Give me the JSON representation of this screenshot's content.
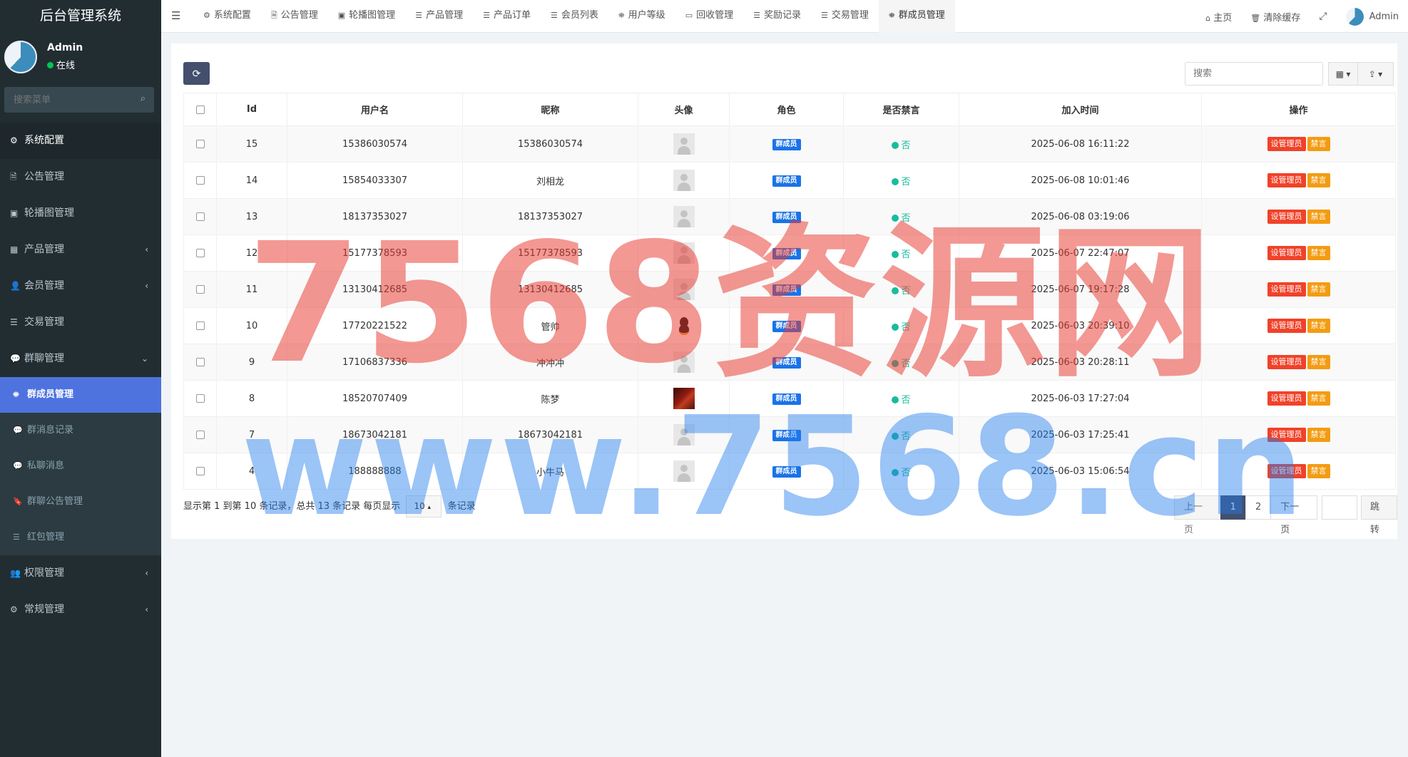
{
  "app": {
    "title": "后台管理系统"
  },
  "user": {
    "name": "Admin",
    "status": "在线"
  },
  "sidebar": {
    "search_placeholder": "搜索菜单",
    "items": [
      {
        "label": "系统配置",
        "icon": "gear-icon",
        "glyph": "⚙",
        "active": true
      },
      {
        "label": "公告管理",
        "icon": "file-icon",
        "glyph": "🗎"
      },
      {
        "label": "轮播图管理",
        "icon": "image-icon",
        "glyph": "▣"
      },
      {
        "label": "产品管理",
        "icon": "grid-icon",
        "glyph": "▦",
        "chevron": "‹"
      },
      {
        "label": "会员管理",
        "icon": "user-icon",
        "glyph": "👤",
        "chevron": "‹"
      },
      {
        "label": "交易管理",
        "icon": "list-icon",
        "glyph": "☰"
      },
      {
        "label": "群聊管理",
        "icon": "comments-icon",
        "glyph": "💬",
        "chevron": "⌄",
        "open": true
      }
    ],
    "group_chat_sub": [
      {
        "label": "群成员管理",
        "icon": "sitemap-icon",
        "glyph": "⛯",
        "active": true
      },
      {
        "label": "群消息记录",
        "icon": "comments-icon",
        "glyph": "💬"
      },
      {
        "label": "私聊消息",
        "icon": "comment-icon",
        "glyph": "💬"
      },
      {
        "label": "群聊公告管理",
        "icon": "bookmark-icon",
        "glyph": "🔖"
      },
      {
        "label": "红包管理",
        "icon": "list-icon",
        "glyph": "☰"
      }
    ],
    "bottom_items": [
      {
        "label": "权限管理",
        "icon": "group-icon",
        "glyph": "👥",
        "chevron": "‹"
      },
      {
        "label": "常规管理",
        "icon": "cogs-icon",
        "glyph": "⚙",
        "chevron": "‹"
      }
    ]
  },
  "topbar": {
    "tabs": [
      {
        "label": "系统配置",
        "icon": "gear-icon",
        "glyph": "⚙"
      },
      {
        "label": "公告管理",
        "icon": "file-icon",
        "glyph": "🗎"
      },
      {
        "label": "轮播图管理",
        "icon": "image-icon",
        "glyph": "▣"
      },
      {
        "label": "产品管理",
        "icon": "list-icon",
        "glyph": "☰"
      },
      {
        "label": "产品订单",
        "icon": "list-icon",
        "glyph": "☰"
      },
      {
        "label": "会员列表",
        "icon": "list-icon",
        "glyph": "☰"
      },
      {
        "label": "用户等级",
        "icon": "sitemap-icon",
        "glyph": "⛯"
      },
      {
        "label": "回收管理",
        "icon": "card-icon",
        "glyph": "▭"
      },
      {
        "label": "奖励记录",
        "icon": "list-icon",
        "glyph": "☰"
      },
      {
        "label": "交易管理",
        "icon": "list-icon",
        "glyph": "☰"
      },
      {
        "label": "群成员管理",
        "icon": "sitemap-icon",
        "glyph": "⛯",
        "active": true
      }
    ],
    "home_label": "主页",
    "clear_cache_label": "清除缓存",
    "user_label": "Admin"
  },
  "toolbar": {
    "search_placeholder": "搜索"
  },
  "table": {
    "columns": [
      "Id",
      "用户名",
      "昵称",
      "头像",
      "角色",
      "是否禁言",
      "加入时间",
      "操作"
    ],
    "role_label": "群成员",
    "mute_label": "否",
    "btn_admin": "设管理员",
    "btn_mute": "禁言",
    "rows": [
      {
        "id": "15",
        "username": "15386030574",
        "nickname": "15386030574",
        "avatar": "default",
        "joined": "2025-06-08 16:11:22"
      },
      {
        "id": "14",
        "username": "15854033307",
        "nickname": "刘相龙",
        "avatar": "default",
        "joined": "2025-06-08 10:01:46"
      },
      {
        "id": "13",
        "username": "18137353027",
        "nickname": "18137353027",
        "avatar": "default",
        "joined": "2025-06-08 03:19:06"
      },
      {
        "id": "12",
        "username": "15177378593",
        "nickname": "15177378593",
        "avatar": "default",
        "joined": "2025-06-07 22:47:07"
      },
      {
        "id": "11",
        "username": "13130412685",
        "nickname": "13130412685",
        "avatar": "default",
        "joined": "2025-06-07 19:17:28"
      },
      {
        "id": "10",
        "username": "17720221522",
        "nickname": "管帅",
        "avatar": "qq",
        "joined": "2025-06-03 20:39:10"
      },
      {
        "id": "9",
        "username": "17106837336",
        "nickname": "冲冲冲",
        "avatar": "default",
        "joined": "2025-06-03 20:28:11"
      },
      {
        "id": "8",
        "username": "18520707409",
        "nickname": "陈梦",
        "avatar": "photo",
        "joined": "2025-06-03 17:27:04"
      },
      {
        "id": "7",
        "username": "18673042181",
        "nickname": "18673042181",
        "avatar": "default",
        "joined": "2025-06-03 17:25:41"
      },
      {
        "id": "4",
        "username": "188888888",
        "nickname": "小牛马",
        "avatar": "default",
        "joined": "2025-06-03 15:06:54"
      }
    ]
  },
  "pagination": {
    "info_prefix": "显示第 1 到第 10 条记录，总共 13 条记录 每页显示",
    "page_size": "10",
    "info_suffix": "条记录",
    "prev": "上一页",
    "pages": [
      "1",
      "2"
    ],
    "current": "1",
    "next": "下一页",
    "jump": "跳转"
  },
  "watermark": {
    "line1": "7568资源网",
    "line2": "www.7568.cn"
  }
}
